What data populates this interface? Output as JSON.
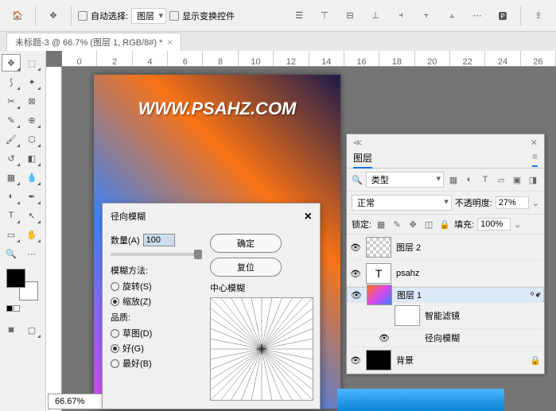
{
  "topbar": {
    "auto_select": "自动选择:",
    "layers": "图层",
    "show_transform": "显示变换控件"
  },
  "tab": {
    "title": "未标题-3 @ 66.7% (图层 1, RGB/8#) *"
  },
  "ruler": [
    "0",
    "2",
    "4",
    "6",
    "8",
    "10",
    "12",
    "14",
    "16",
    "18",
    "20",
    "22",
    "24",
    "26"
  ],
  "canvas_text": "WWW.PSAHZ.COM",
  "zoom": "66.67%",
  "dialog": {
    "title": "径向模糊",
    "amount_label": "数量(A)",
    "amount_value": "100",
    "ok": "确定",
    "reset": "复位",
    "method_label": "模糊方法:",
    "spin": "旋转(S)",
    "zoom_m": "缩放(Z)",
    "quality_label": "品质:",
    "draft": "草图(D)",
    "good": "好(G)",
    "best": "最好(B)",
    "preview_label": "中心模糊"
  },
  "layers": {
    "title": "图层",
    "kind": "类型",
    "blend": "正常",
    "opacity_label": "不透明度:",
    "opacity": "27%",
    "lock_label": "锁定:",
    "fill_label": "填充:",
    "fill": "100%",
    "items": [
      {
        "name": "图层 2",
        "eye": "👁",
        "type": "checker"
      },
      {
        "name": "psahz",
        "eye": "👁",
        "type": "text"
      },
      {
        "name": "图层 1",
        "eye": "👁",
        "type": "img",
        "sel": true,
        "badge": "ᴼ▾"
      },
      {
        "name": "智能滤镜",
        "eye": "",
        "type": "white",
        "indent": true
      },
      {
        "name": "径向模糊",
        "eye": "👁",
        "type": "none",
        "indent": true
      },
      {
        "name": "背景",
        "eye": "👁",
        "type": "black",
        "lock": "🔒"
      }
    ]
  }
}
